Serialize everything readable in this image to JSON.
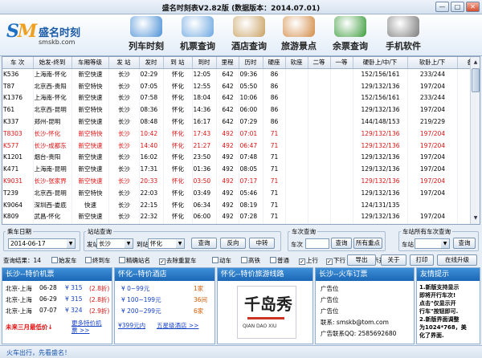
{
  "window": {
    "title": "盛名时刻表V2.82版 (数据版本：2014.07.01)"
  },
  "logo": {
    "mark": "SM",
    "name": "盛名时刻",
    "url": "smskb.com"
  },
  "nav": [
    {
      "label": "列车时刻",
      "icon": "train-icon",
      "color": "#4a8fd6"
    },
    {
      "label": "机票查询",
      "icon": "airplane-icon",
      "color": "#6aa6e0"
    },
    {
      "label": "酒店查询",
      "icon": "hotel-icon",
      "color": "#c8a060"
    },
    {
      "label": "旅游景点",
      "icon": "scenery-icon",
      "color": "#d28a44"
    },
    {
      "label": "余票查询",
      "icon": "windows-icon",
      "color": "#3b9b3b"
    },
    {
      "label": "手机软件",
      "icon": "phone-icon",
      "color": "#7a7a7a"
    }
  ],
  "table": {
    "headers": [
      "车 次",
      "始发-终到",
      "车厢等级",
      "发 站",
      "发时",
      "到 站",
      "到时",
      "里程",
      "历时",
      "硬座",
      "软座",
      "二等",
      "一等",
      "硬卧上/中/下",
      "软卧上/下",
      "备注"
    ],
    "rows": [
      {
        "red": false,
        "cells": [
          "K536",
          "上海南-怀化",
          "新空快速",
          "长沙",
          "02:29",
          "怀化",
          "12:05",
          "642",
          "09:36",
          "86",
          "",
          "",
          "",
          "152/156/161",
          "233/244",
          ""
        ]
      },
      {
        "red": false,
        "cells": [
          "T87",
          "北京西-贵阳",
          "新空特快",
          "长沙",
          "07:05",
          "怀化",
          "12:55",
          "642",
          "05:50",
          "86",
          "",
          "",
          "",
          "129/132/136",
          "197/204",
          ""
        ]
      },
      {
        "red": false,
        "cells": [
          "K1376",
          "上海南-怀化",
          "新空快速",
          "长沙",
          "07:58",
          "怀化",
          "18:04",
          "642",
          "10:06",
          "86",
          "",
          "",
          "",
          "152/156/161",
          "233/244",
          ""
        ]
      },
      {
        "red": false,
        "cells": [
          "T61",
          "北京西-昆明",
          "新空特快",
          "长沙",
          "08:36",
          "怀化",
          "14:36",
          "642",
          "06:00",
          "86",
          "",
          "",
          "",
          "129/132/136",
          "197/204",
          ""
        ]
      },
      {
        "red": false,
        "cells": [
          "K337",
          "郑州-昆明",
          "新空快速",
          "长沙",
          "08:48",
          "怀化",
          "16:17",
          "642",
          "07:29",
          "86",
          "",
          "",
          "",
          "144/148/153",
          "219/229",
          ""
        ]
      },
      {
        "red": true,
        "cells": [
          "T8303",
          "长沙-怀化",
          "新空特快",
          "长沙",
          "10:42",
          "怀化",
          "17:43",
          "492",
          "07:01",
          "71",
          "",
          "",
          "",
          "129/132/136",
          "197/204",
          ""
        ]
      },
      {
        "red": true,
        "cells": [
          "K577",
          "长沙-成都东",
          "新空快速",
          "长沙",
          "14:40",
          "怀化",
          "21:27",
          "492",
          "06:47",
          "71",
          "",
          "",
          "",
          "129/132/136",
          "197/204",
          ""
        ]
      },
      {
        "red": false,
        "cells": [
          "K1201",
          "烟台-贵阳",
          "新空快速",
          "长沙",
          "16:02",
          "怀化",
          "23:50",
          "492",
          "07:48",
          "71",
          "",
          "",
          "",
          "129/132/136",
          "197/204",
          ""
        ]
      },
      {
        "red": false,
        "cells": [
          "K471",
          "上海南-昆明",
          "新空快速",
          "长沙",
          "17:31",
          "怀化",
          "01:36",
          "492",
          "08:05",
          "71",
          "",
          "",
          "",
          "129/132/136",
          "197/204",
          ""
        ]
      },
      {
        "red": true,
        "cells": [
          "K9031",
          "长沙-张家界",
          "新空快速",
          "长沙",
          "20:33",
          "怀化",
          "03:50",
          "492",
          "07:17",
          "71",
          "",
          "",
          "",
          "129/132/136",
          "197/204",
          ""
        ]
      },
      {
        "red": false,
        "cells": [
          "T239",
          "北京西-昆明",
          "新空特快",
          "长沙",
          "22:03",
          "怀化",
          "03:49",
          "492",
          "05:46",
          "71",
          "",
          "",
          "",
          "129/132/136",
          "197/204",
          ""
        ]
      },
      {
        "red": false,
        "cells": [
          "K9064",
          "深圳西-娄底",
          "快速",
          "长沙",
          "22:15",
          "怀化",
          "06:34",
          "492",
          "08:19",
          "71",
          "",
          "",
          "",
          "124/131/135",
          "",
          ""
        ]
      },
      {
        "red": false,
        "cells": [
          "K809",
          "武昌-怀化",
          "新空快速",
          "长沙",
          "22:32",
          "怀化",
          "06:00",
          "492",
          "07:28",
          "71",
          "",
          "",
          "",
          "129/132/136",
          "197/204",
          ""
        ]
      },
      {
        "red": false,
        "cells": [
          "K109",
          "武昌-昆明",
          "新空快速",
          "长沙",
          "23:32",
          "怀化",
          "07:03",
          "492",
          "07:31",
          "71",
          "",
          "",
          "",
          "129/132/136",
          "197/204",
          ""
        ]
      }
    ]
  },
  "query": {
    "date_group": "乘车日期",
    "date_value": "2014-06-17",
    "station_group": "站站查询",
    "from_label": "发站",
    "from_value": "长沙",
    "to_label": "到站",
    "to_value": "怀化",
    "search_btn": "查询",
    "reverse_btn": "反向",
    "transfer_btn": "中转",
    "train_group": "车次查询",
    "train_label": "车次",
    "train_search_btn": "查询",
    "all_stops_btn": "所有重点",
    "allstation_group": "车站所有车次查询",
    "allstation_label": "车站",
    "allstation_btn": "查询"
  },
  "filters": {
    "result_text": "查询结果：14",
    "items": [
      {
        "label": "始发车",
        "checked": false
      },
      {
        "label": "终到车",
        "checked": false
      },
      {
        "label": "精确站名",
        "checked": false
      },
      {
        "label": "去除重复车",
        "checked": true
      },
      {
        "label": "动车",
        "checked": false
      },
      {
        "label": "高铁",
        "checked": false
      },
      {
        "label": "普通",
        "checked": false
      },
      {
        "label": "上行",
        "checked": true
      },
      {
        "label": "下行",
        "checked": true
      },
      {
        "label": "仅显示开行",
        "checked": false
      }
    ],
    "buttons": [
      "导出",
      "关于",
      "打印",
      "在线升级"
    ]
  },
  "ads": {
    "flight": {
      "title": "长沙--特价机票",
      "rows": [
        {
          "route": "北京-上海",
          "date": "06-28",
          "price": "¥ 315",
          "disc": "(2.8折)"
        },
        {
          "route": "北京-上海",
          "date": "06-29",
          "price": "¥ 315",
          "disc": "(2.8折)"
        },
        {
          "route": "北京-上海",
          "date": "07-07",
          "price": "¥ 324",
          "disc": "(2.9折)"
        }
      ],
      "promo": "未来三月最低价↓",
      "more": "更多特价机票 >>"
    },
    "hotel": {
      "title": "怀化--特价酒店",
      "rows": [
        {
          "price": "¥ 0~99元",
          "count": "1家"
        },
        {
          "price": "¥ 100~199元",
          "count": "36间"
        },
        {
          "price": "¥ 200~299元",
          "count": "6家"
        }
      ],
      "cheap": "¥399元内",
      "star": "五星级酒店 >>"
    },
    "travel": {
      "title": "怀化--特价旅游线路",
      "brand": "千岛秀",
      "brand_py": "QIAN DAO XIU"
    },
    "railway": {
      "title": "长沙--火车订票",
      "lines": [
        "广告位",
        "广告位",
        "广告位",
        "联系: smskb@tom.com",
        "广告联系QQ: 2585692680"
      ]
    },
    "tips": {
      "title": "友情提示",
      "lines": [
        "1.新版支持显示",
        "即将开行车次!",
        "点击\"仅显示开",
        "行车\"按钮即可.",
        "2.新版界面调整",
        "为1024*768，美",
        "化了界面."
      ]
    }
  },
  "status": {
    "text": "火车出行，先看盛名！"
  }
}
